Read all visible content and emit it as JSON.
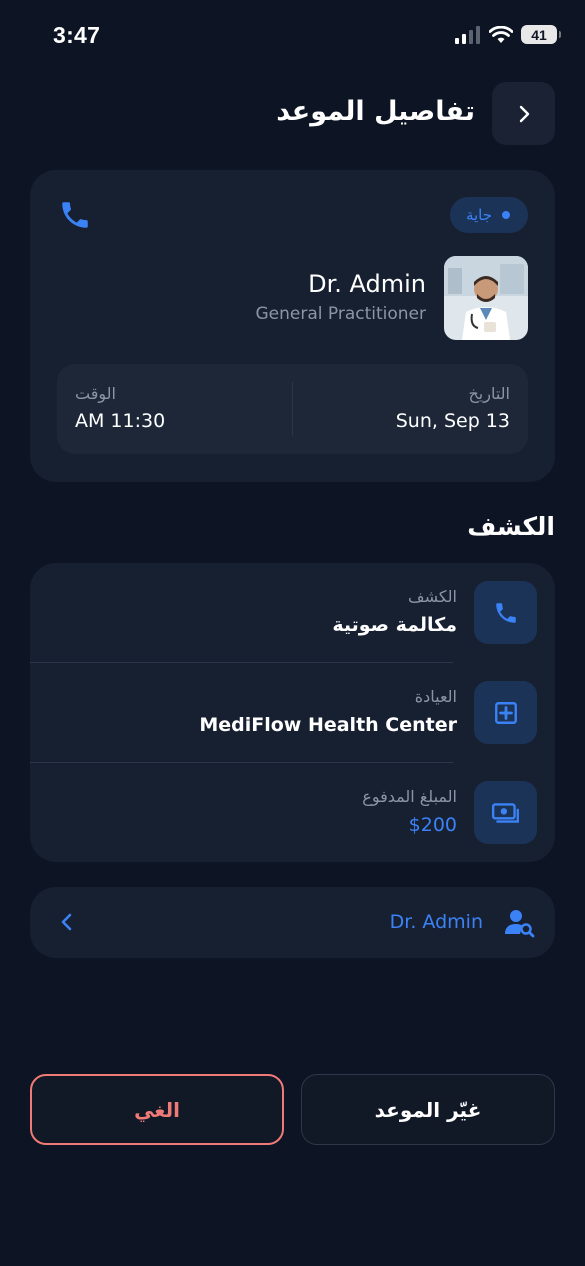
{
  "status_bar": {
    "time": "3:47",
    "battery": "41"
  },
  "header": {
    "title": "تفاصيل الموعد"
  },
  "appointment": {
    "status_badge": "جاية",
    "doctor_name": "Dr. Admin",
    "doctor_specialty": "General Practitioner",
    "date_label": "التاريخ",
    "date_value": "Sun, Sep 13",
    "time_label": "الوقت",
    "time_value": "AM 11:30"
  },
  "section": {
    "title": "الكشف"
  },
  "details": [
    {
      "label": "الكشف",
      "value": "مكالمة صوتية",
      "icon": "phone-icon"
    },
    {
      "label": "العيادة",
      "value": "MediFlow Health Center",
      "icon": "medical-plus-icon"
    },
    {
      "label": "المبلغ المدفوع",
      "value": "$200",
      "icon": "cash-icon"
    }
  ],
  "doctor_link": {
    "name": "Dr. Admin"
  },
  "buttons": {
    "reschedule": "غيّر الموعد",
    "cancel": "الغي"
  },
  "colors": {
    "background": "#0d1423",
    "card": "#172031",
    "accent": "#3b82f6",
    "danger": "#f07a78"
  }
}
